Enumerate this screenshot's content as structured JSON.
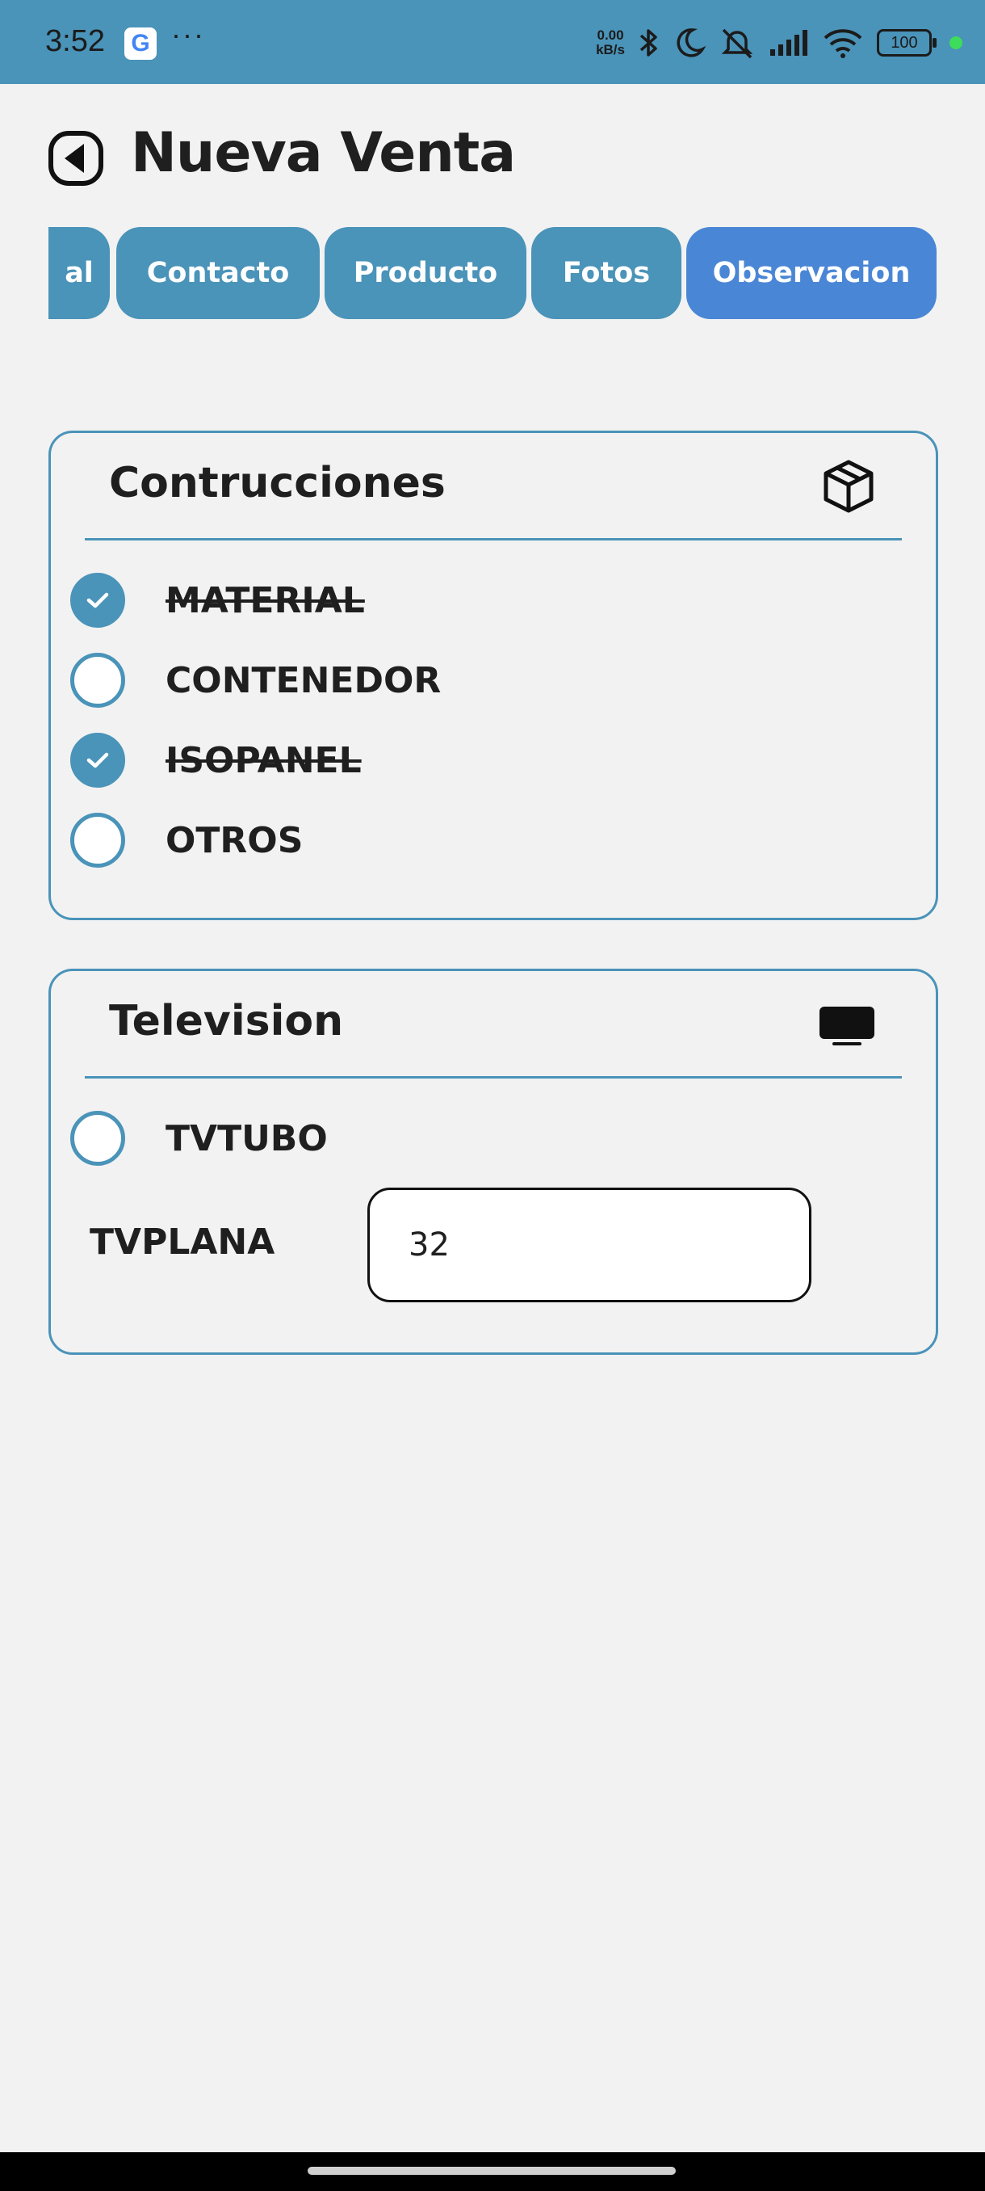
{
  "status_bar": {
    "time": "3:52",
    "google_badge": "G",
    "more": "···",
    "net_speed_value": "0.00",
    "net_speed_unit": "kB/s",
    "battery": "100",
    "dot_color": "#3ddc5b"
  },
  "header": {
    "title": "Nueva Venta",
    "back_icon": "back-arrow-icon"
  },
  "tabs": [
    {
      "label": "al",
      "active": false
    },
    {
      "label": "Contacto",
      "active": false
    },
    {
      "label": "Producto",
      "active": false
    },
    {
      "label": "Fotos",
      "active": false
    },
    {
      "label": "Observacion",
      "active": true
    }
  ],
  "construcciones": {
    "title": "Contrucciones",
    "icon": "package-icon",
    "options": [
      {
        "label": "MATERIAL",
        "checked": true
      },
      {
        "label": "CONTENEDOR",
        "checked": false
      },
      {
        "label": "ISOPANEL",
        "checked": true
      },
      {
        "label": "OTROS",
        "checked": false
      }
    ]
  },
  "television": {
    "title": "Television",
    "icon": "tv-icon",
    "options": [
      {
        "label": "TVTUBO",
        "checked": false
      }
    ],
    "tvplana_label": "TVPLANA",
    "tvplana_value": "32"
  },
  "colors": {
    "primary": "#4a93b9",
    "active_tab": "#4a86d6",
    "background": "#f2f2f2"
  }
}
